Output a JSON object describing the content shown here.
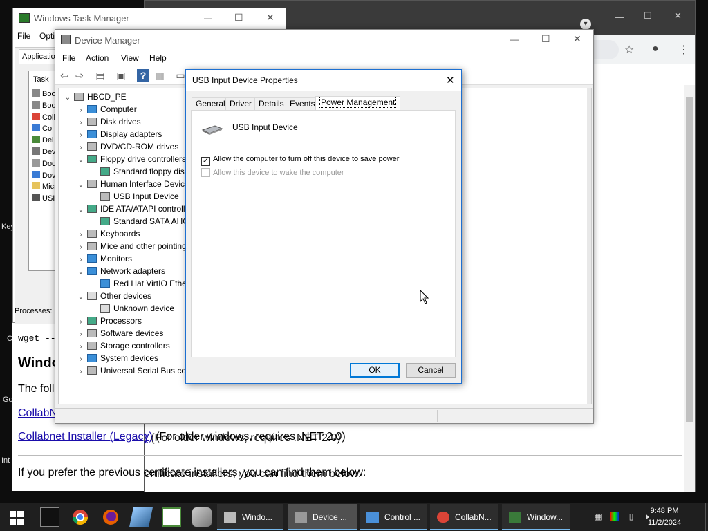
{
  "desktop": {
    "fragments": [
      "Key",
      "C",
      "Go",
      "Int"
    ]
  },
  "browser": {
    "page": {
      "cmd_snippet": "wget --c",
      "heading": "Windo",
      "intro": "The foll",
      "link1": "CollabN",
      "link2": "Collabnet Installer (Legacy)",
      "link2_suffix": " (For older windows, requires .NET 2.0)",
      "footer_text": "If you prefer the previous certificate installers, you can find them below:"
    }
  },
  "taskmgr": {
    "title": "Windows Task Manager",
    "menu": [
      "File",
      "Opti"
    ],
    "tab": "Applicatio",
    "list_header": "Task",
    "items": [
      "Boo",
      "Boo",
      "Coll",
      "Co",
      "Del",
      "Dev",
      "Doc",
      "Dov",
      "Micr",
      "USI"
    ],
    "processes": "Processes: "
  },
  "devmgr": {
    "title": "Device Manager",
    "menu": [
      "File",
      "Action",
      "View",
      "Help"
    ],
    "tree": [
      {
        "label": "HBCD_PE",
        "level": 0,
        "exp": "v"
      },
      {
        "label": "Computer",
        "level": 1,
        "exp": ">"
      },
      {
        "label": "Disk drives",
        "level": 1,
        "exp": ">"
      },
      {
        "label": "Display adapters",
        "level": 1,
        "exp": ">"
      },
      {
        "label": "DVD/CD-ROM drives",
        "level": 1,
        "exp": ">"
      },
      {
        "label": "Floppy drive controllers",
        "level": 1,
        "exp": "v"
      },
      {
        "label": "Standard floppy disk controller",
        "level": 2,
        "exp": ""
      },
      {
        "label": "Human Interface Devices",
        "level": 1,
        "exp": "v"
      },
      {
        "label": "USB Input Device",
        "level": 2,
        "exp": ""
      },
      {
        "label": "IDE ATA/ATAPI controllers",
        "level": 1,
        "exp": "v"
      },
      {
        "label": "Standard SATA AHCI Controller",
        "level": 2,
        "exp": ""
      },
      {
        "label": "Keyboards",
        "level": 1,
        "exp": ">"
      },
      {
        "label": "Mice and other pointing devices",
        "level": 1,
        "exp": ">"
      },
      {
        "label": "Monitors",
        "level": 1,
        "exp": ">"
      },
      {
        "label": "Network adapters",
        "level": 1,
        "exp": "v"
      },
      {
        "label": "Red Hat VirtIO Ethernet Adapter",
        "level": 2,
        "exp": ""
      },
      {
        "label": "Other devices",
        "level": 1,
        "exp": "v"
      },
      {
        "label": "Unknown device",
        "level": 2,
        "exp": ""
      },
      {
        "label": "Processors",
        "level": 1,
        "exp": ">"
      },
      {
        "label": "Software devices",
        "level": 1,
        "exp": ">"
      },
      {
        "label": "Storage controllers",
        "level": 1,
        "exp": ">"
      },
      {
        "label": "System devices",
        "level": 1,
        "exp": ">"
      },
      {
        "label": "Universal Serial Bus controllers",
        "level": 1,
        "exp": ">"
      }
    ]
  },
  "props": {
    "title": "USB Input Device Properties",
    "tabs": [
      "General",
      "Driver",
      "Details",
      "Events",
      "Power Management"
    ],
    "device_name": "USB Input Device",
    "opt_turn_off": "Allow the computer to turn off this device to save power",
    "opt_wake": "Allow this device to wake the computer",
    "ok": "OK",
    "cancel": "Cancel"
  },
  "taskbar": {
    "tasks": [
      "Windo...",
      "Device ...",
      "Control ...",
      "CollabN...",
      "Window..."
    ],
    "time": "9:48 PM",
    "date": "11/2/2024"
  },
  "colors": {
    "accent": "#0078d7",
    "taskbar": "#1f1f1f"
  }
}
